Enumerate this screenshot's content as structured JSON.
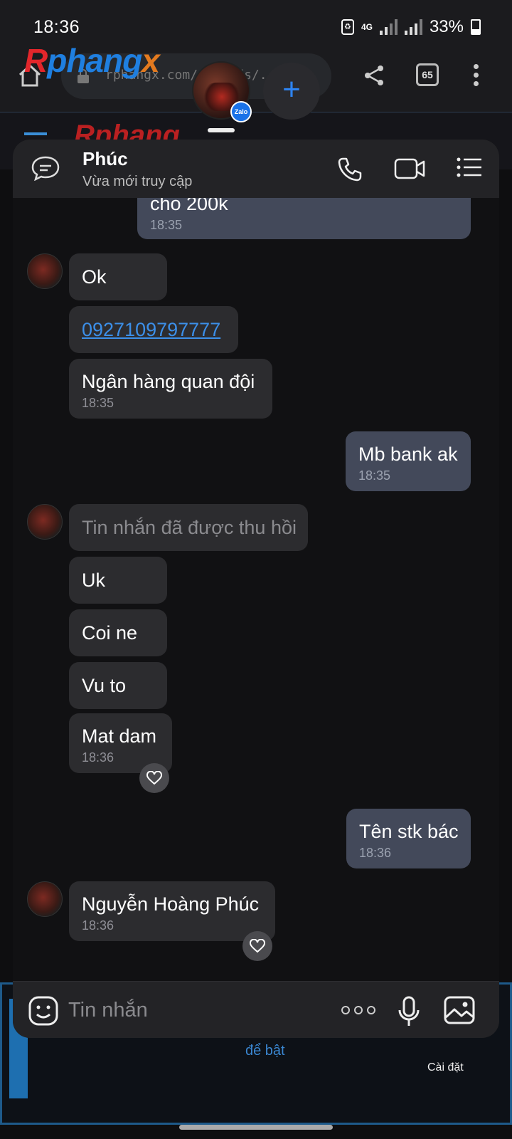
{
  "status_bar": {
    "time": "18:36",
    "network": "4G",
    "battery": "33%"
  },
  "browser": {
    "url": "rphangx.com/threads/...o",
    "tab_count": "65"
  },
  "site": {
    "logo_r": "R",
    "logo_phang": "phang",
    "logo_x": "x",
    "bottom_link": "để bật",
    "settings_label": "Cài đặt"
  },
  "chat_head": {
    "badge": "Zalo",
    "plus": "+"
  },
  "chat": {
    "contact_name": "Phúc",
    "contact_status": "Vừa mới truy cập",
    "messages": [
      {
        "dir": "out",
        "text": "cho 200k",
        "time": "18:35"
      },
      {
        "dir": "in",
        "text": "Ok",
        "time": ""
      },
      {
        "dir": "in",
        "text": "0927109797777",
        "time": "",
        "link": true
      },
      {
        "dir": "in",
        "text": "Ngân hàng quan đội",
        "time": "18:35"
      },
      {
        "dir": "out",
        "text": "Mb bank ak",
        "time": "18:35"
      },
      {
        "dir": "in",
        "text": "Tin nhắn đã được thu hồi",
        "time": "",
        "recalled": true
      },
      {
        "dir": "in",
        "text": "Uk",
        "time": ""
      },
      {
        "dir": "in",
        "text": "Coi ne",
        "time": ""
      },
      {
        "dir": "in",
        "text": "Vu to",
        "time": ""
      },
      {
        "dir": "in",
        "text": "Mat dam",
        "time": "18:36"
      },
      {
        "dir": "out",
        "text": "Tên stk bác",
        "time": "18:36"
      },
      {
        "dir": "in",
        "text": "Nguyễn Hoàng Phúc",
        "time": "18:36"
      }
    ],
    "composer_placeholder": "Tin nhắn"
  },
  "colors": {
    "accent": "#2e83f0",
    "incoming_bubble": "#2c2c2f",
    "outgoing_bubble": "#43495a",
    "link": "#3c8fe8"
  }
}
